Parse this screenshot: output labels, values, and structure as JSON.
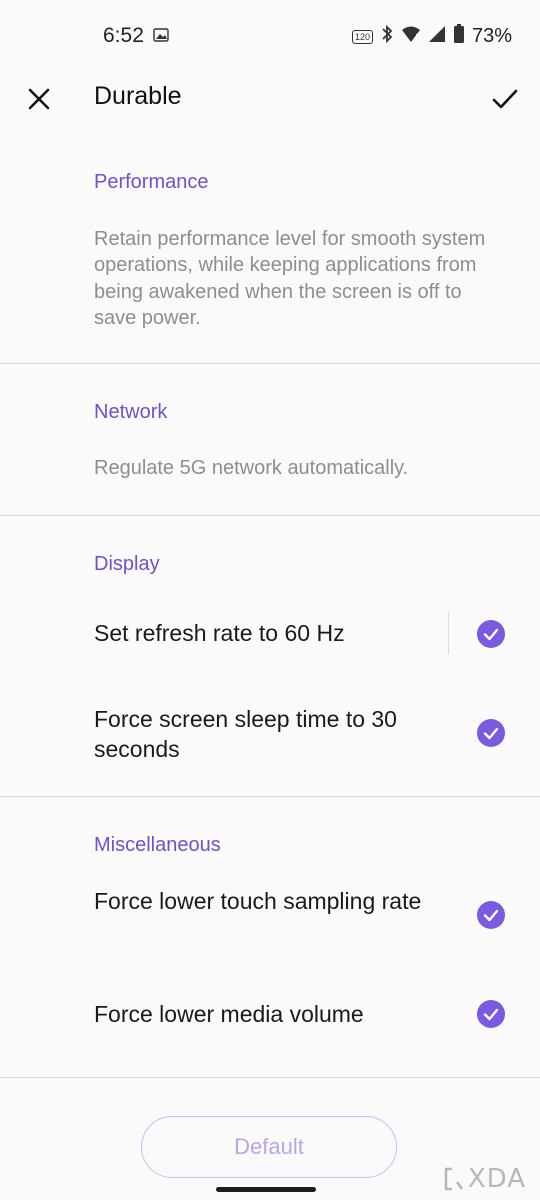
{
  "status": {
    "time": "6:52",
    "refresh_badge": "120",
    "battery_percent": "73%"
  },
  "header": {
    "title": "Durable"
  },
  "sections": {
    "performance": {
      "heading": "Performance",
      "description": "Retain performance level for smooth system operations, while keeping applications from being awakened when the screen is off to save power."
    },
    "network": {
      "heading": "Network",
      "description": "Regulate 5G network automatically."
    },
    "display": {
      "heading": "Display",
      "items": [
        {
          "label": "Set refresh rate to 60 Hz",
          "checked": true
        },
        {
          "label": "Force screen sleep time to 30 seconds",
          "checked": true
        }
      ]
    },
    "misc": {
      "heading": "Miscellaneous",
      "items": [
        {
          "label": "Force lower touch sampling rate",
          "checked": true
        },
        {
          "label": "Force lower media volume",
          "checked": true
        }
      ]
    }
  },
  "footer": {
    "default_label": "Default"
  },
  "watermark": {
    "text": "XDA"
  },
  "colors": {
    "accent": "#7a5ae0",
    "heading": "#6f52cc",
    "muted_text": "#8e8e8e"
  }
}
